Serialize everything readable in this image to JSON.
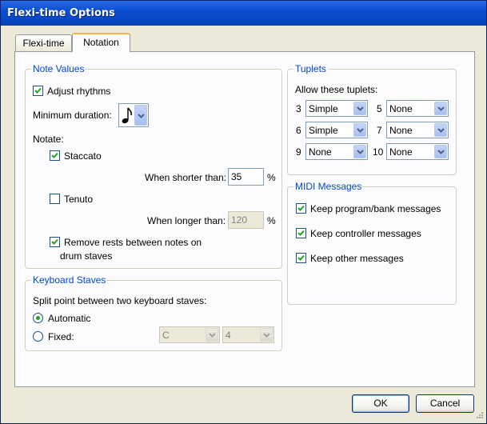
{
  "window": {
    "title": "Flexi-time Options"
  },
  "tabs": [
    {
      "label": "Flexi-time"
    },
    {
      "label": "Notation"
    }
  ],
  "note_values": {
    "legend": "Note Values",
    "adjust_rhythms_label": "Adjust rhythms",
    "adjust_rhythms_checked": true,
    "minimum_duration_label": "Minimum duration:",
    "notate_label": "Notate:",
    "staccato_label": "Staccato",
    "staccato_checked": true,
    "when_shorter_label": "When shorter than:",
    "when_shorter_value": "35",
    "percent_1": "%",
    "tenuto_label": "Tenuto",
    "tenuto_checked": false,
    "when_longer_label": "When longer than:",
    "when_longer_value": "120",
    "percent_2": "%",
    "remove_rests_label_line1": "Remove rests between notes on",
    "remove_rests_label_line2": "drum staves",
    "remove_rests_checked": true
  },
  "keyboard_staves": {
    "legend": "Keyboard Staves",
    "split_label": "Split point between two keyboard staves:",
    "automatic_label": "Automatic",
    "fixed_label": "Fixed:",
    "selected": "automatic",
    "note_value": "C",
    "octave_value": "4"
  },
  "tuplets": {
    "legend": "Tuplets",
    "allow_label": "Allow these tuplets:",
    "rows": [
      {
        "n3": "3",
        "v3": "Simple",
        "n5": "5",
        "v5": "None"
      },
      {
        "n3": "6",
        "v3": "Simple",
        "n5": "7",
        "v5": "None"
      },
      {
        "n3": "9",
        "v3": "None",
        "n5": "10",
        "v5": "None"
      }
    ]
  },
  "midi": {
    "legend": "MIDI Messages",
    "items": [
      {
        "label": "Keep program/bank messages",
        "checked": true
      },
      {
        "label": "Keep controller messages",
        "checked": true
      },
      {
        "label": "Keep other messages",
        "checked": true
      }
    ]
  },
  "buttons": {
    "ok": "OK",
    "cancel": "Cancel"
  },
  "icons": {
    "eighth_note": "eighth-note-icon",
    "check": "check-icon",
    "dropdown": "chevron-down-icon"
  }
}
